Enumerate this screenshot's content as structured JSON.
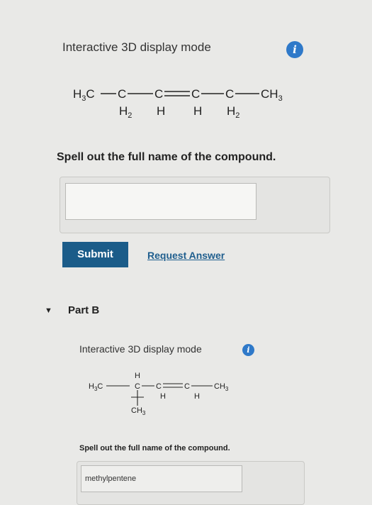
{
  "part_a": {
    "mode_label": "Interactive 3D display mode",
    "info_icon_glyph": "i",
    "structure": {
      "group1": "H3C",
      "c2": "C",
      "c2_h": "H2",
      "c3": "C",
      "c3_h": "H",
      "c4": "C",
      "c4_h": "H",
      "c5": "C",
      "c5_h": "H2",
      "group6": "CH3"
    },
    "instruction": "Spell out the full name of the compound.",
    "answer_value": "",
    "submit_label": "Submit",
    "request_label": "Request Answer"
  },
  "part_b": {
    "label": "Part B",
    "collapse_glyph": "▼",
    "mode_label": "Interactive 3D display mode",
    "info_icon_glyph": "i",
    "structure": {
      "group1": "H3C",
      "c2": "C",
      "c2_top_h": "H",
      "c2_branch": "CH3",
      "c3": "C",
      "c3_h": "H",
      "c4": "C",
      "c4_h": "H",
      "group5": "CH3"
    },
    "instruction": "Spell out the full name of the compound.",
    "answer_value": "methylpentene"
  },
  "colors": {
    "background": "#e9e9e7",
    "primary_button": "#1b5c89",
    "link": "#1f5e8e",
    "info": "#2f79c9"
  }
}
